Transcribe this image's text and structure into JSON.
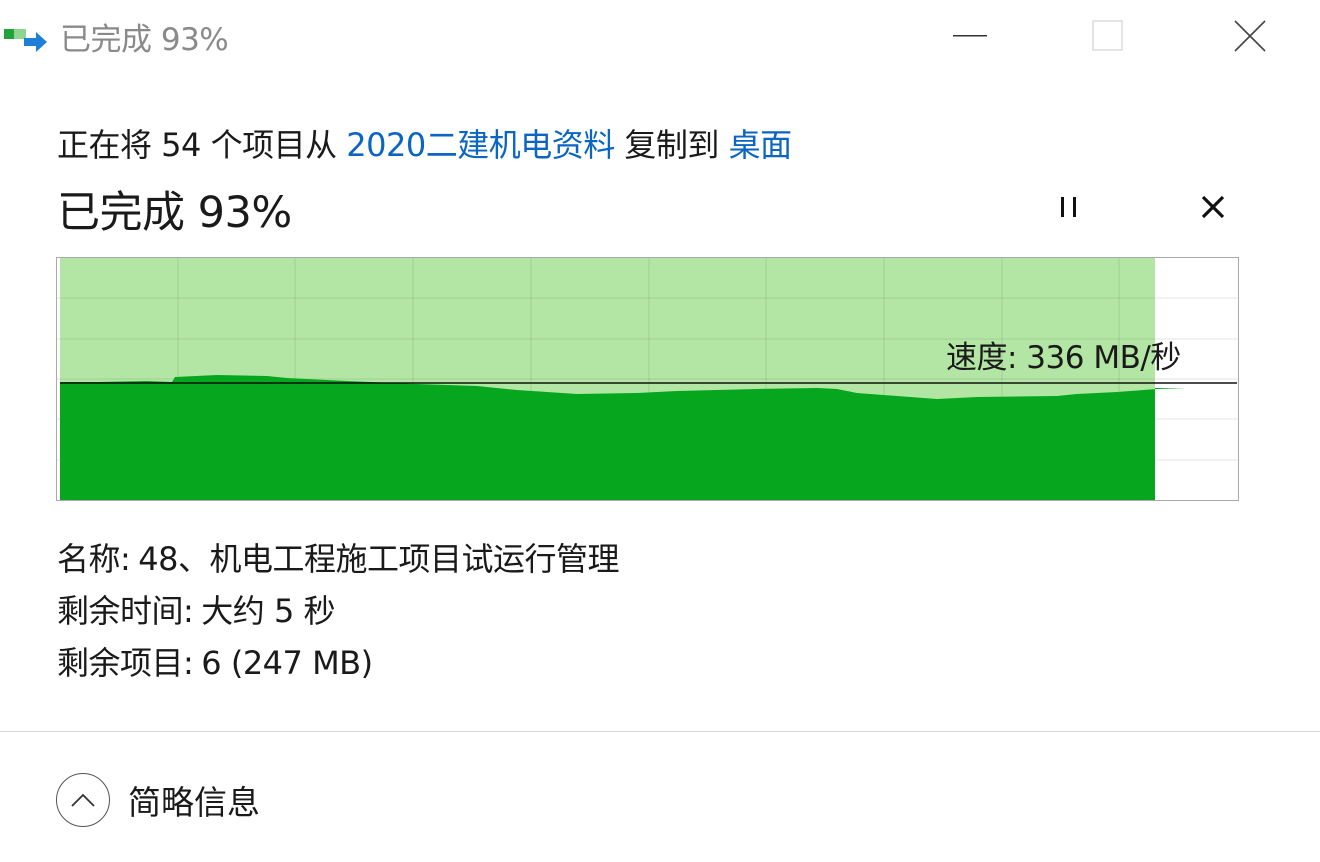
{
  "window": {
    "title": "已完成 93%",
    "icon": "file-copy-icon"
  },
  "description": {
    "prefix": "正在将 54 个项目从 ",
    "source": "2020二建机电资料",
    "middle": " 复制到 ",
    "destination": "桌面"
  },
  "progress": {
    "title": "已完成 93%",
    "percent": 93,
    "speed_label": "速度: 336 MB/秒"
  },
  "details": {
    "name_label": "名称:",
    "name_value": "48、机电工程施工项目试运行管理",
    "time_label": "剩余时间:",
    "time_value": "大约 5 秒",
    "items_label": "剩余项目:",
    "items_value": "6 (247 MB)"
  },
  "footer": {
    "toggle_label": "简略信息",
    "toggle_icon": "chevron-up-icon"
  },
  "colors": {
    "progress_fill": "#b3e6a4",
    "speed_fill": "#06a61f",
    "link": "#0a66c2"
  }
}
